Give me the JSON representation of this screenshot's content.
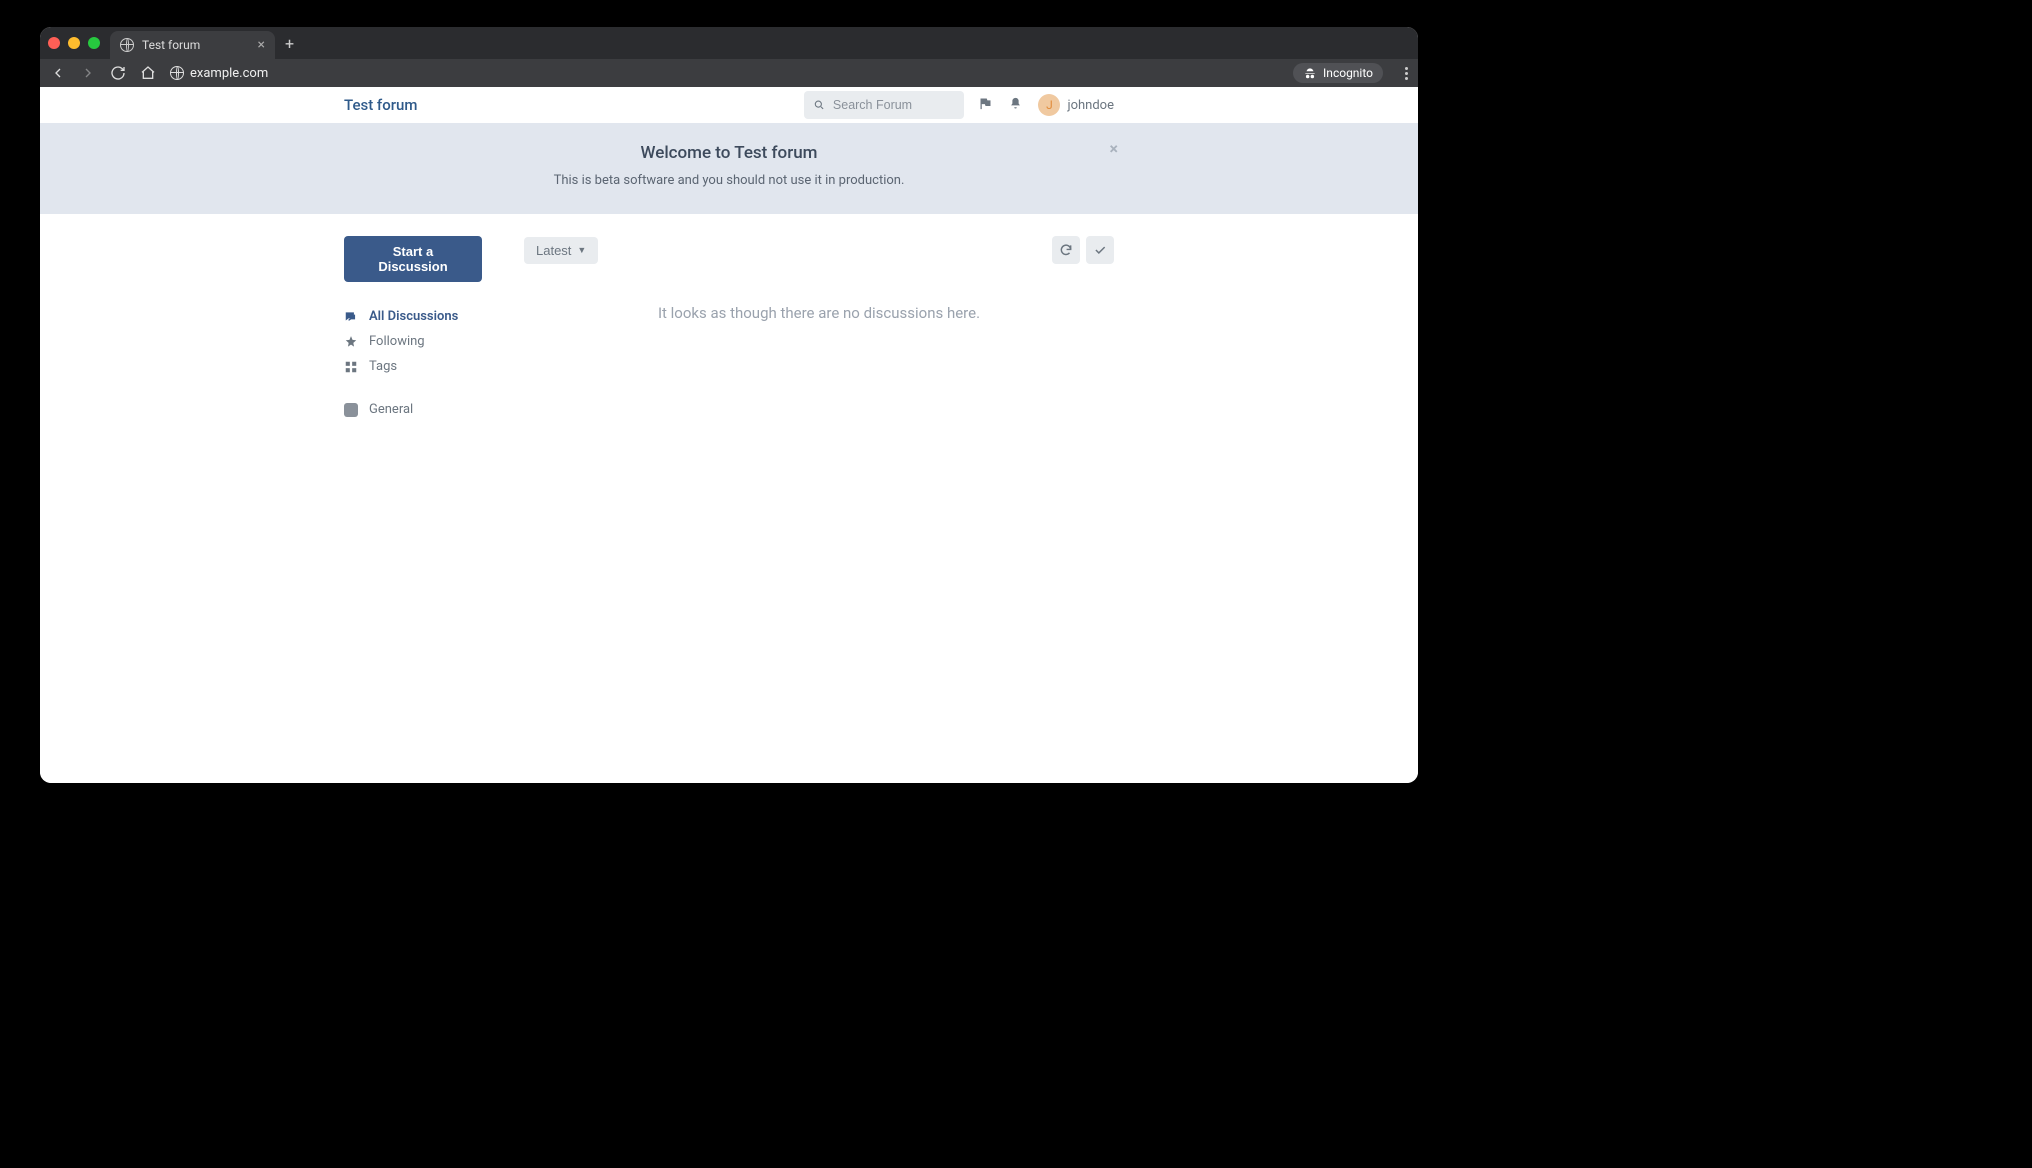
{
  "browser": {
    "tab_title": "Test forum",
    "url": "example.com",
    "incognito_label": "Incognito"
  },
  "header": {
    "site_title": "Test forum",
    "search_placeholder": "Search Forum",
    "username": "johndoe",
    "avatar_initial": "J"
  },
  "hero": {
    "title": "Welcome to Test forum",
    "subtitle": "This is beta software and you should not use it in production."
  },
  "sidebar": {
    "start_button": "Start a Discussion",
    "items": [
      {
        "label": "All Discussions"
      },
      {
        "label": "Following"
      },
      {
        "label": "Tags"
      }
    ],
    "tags": [
      {
        "label": "General"
      }
    ]
  },
  "content": {
    "sort_label": "Latest",
    "empty_message": "It looks as though there are no discussions here."
  }
}
